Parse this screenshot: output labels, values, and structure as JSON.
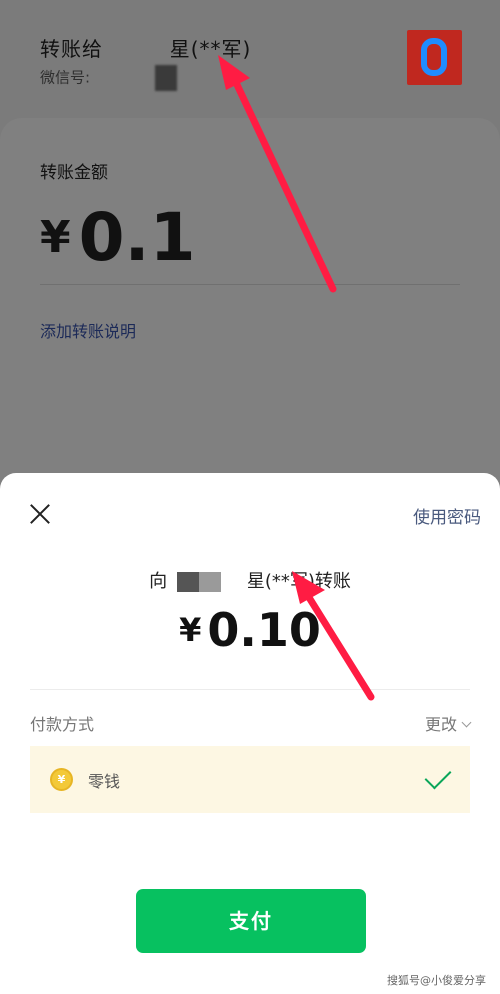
{
  "background": {
    "transfer_to_label": "转账给",
    "recipient_name_visible": "星(**军)",
    "wechat_id_label": "微信号:",
    "amount_label": "转账金额",
    "currency_symbol": "¥",
    "amount": "0.1",
    "add_note_link": "添加转账说明"
  },
  "sheet": {
    "use_password": "使用密码",
    "pay_to_prefix": "向",
    "pay_to_name": "星(**军)",
    "pay_to_suffix": "转账",
    "currency_symbol": "¥",
    "amount": "0.10",
    "payment_method_label": "付款方式",
    "change_label": "更改",
    "selected_method": "零钱",
    "pay_button": "支付"
  },
  "watermark": "搜狐号@小俊爱分享",
  "colors": {
    "accent_green": "#07c160",
    "link_blue": "#4a5a7e",
    "annotation_red": "#ff1c43"
  }
}
